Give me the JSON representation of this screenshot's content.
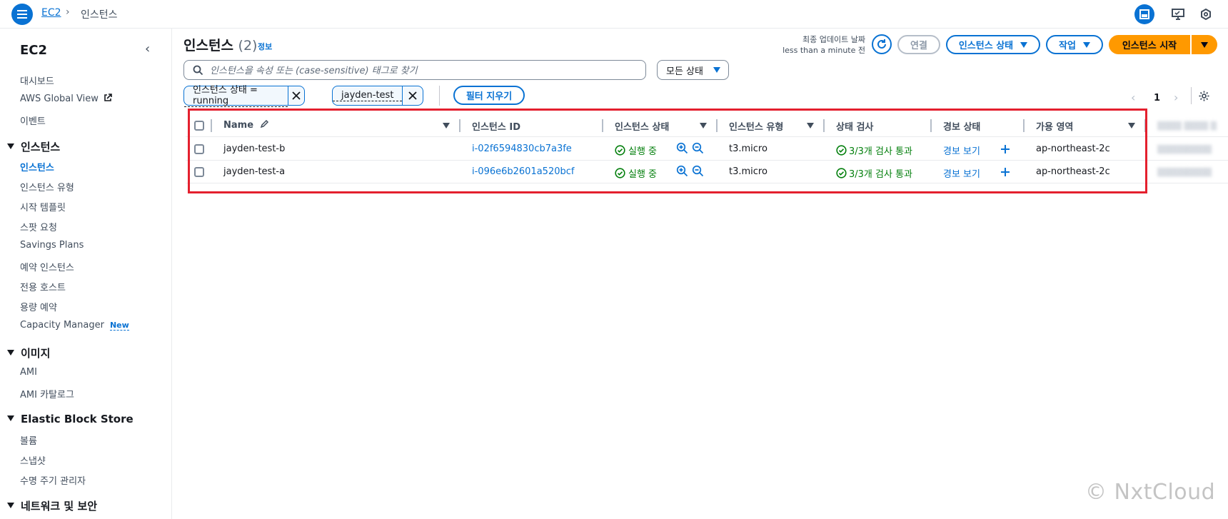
{
  "topbar": {
    "breadcrumb": [
      "EC2",
      "인스턴스"
    ]
  },
  "sidebar": {
    "title": "EC2",
    "top_items": [
      {
        "label": "대시보드"
      },
      {
        "label": "AWS Global View"
      },
      {
        "label": "이벤트"
      }
    ],
    "sections": [
      {
        "title": "인스턴스",
        "items": [
          {
            "label": "인스턴스",
            "active": true
          },
          {
            "label": "인스턴스 유형"
          },
          {
            "label": "시작 템플릿"
          },
          {
            "label": "스팟 요청"
          },
          {
            "label": "Savings Plans"
          },
          {
            "label": "예약 인스턴스"
          },
          {
            "label": "전용 호스트"
          },
          {
            "label": "용량 예약"
          },
          {
            "label": "Capacity Manager",
            "badge": "New"
          }
        ]
      },
      {
        "title": "이미지",
        "items": [
          {
            "label": "AMI"
          },
          {
            "label": "AMI 카탈로그"
          }
        ]
      },
      {
        "title": "Elastic Block Store",
        "items": [
          {
            "label": "볼륨"
          },
          {
            "label": "스냅샷"
          },
          {
            "label": "수명 주기 관리자"
          }
        ]
      },
      {
        "title": "네트워크 및 보안",
        "items": []
      }
    ]
  },
  "header": {
    "title": "인스턴스",
    "count": "(2)",
    "info": "정보",
    "last_update_label": "최종 업데이트 날짜",
    "last_update_value": "less than a minute 전",
    "connect": "연결",
    "instance_state": "인스턴스 상태",
    "actions": "작업",
    "launch": "인스턴스 시작"
  },
  "search": {
    "placeholder": "인스턴스을 속성 또는 (case-sensitive) 태그로 찾기",
    "status_select": "모든 상태"
  },
  "filters": {
    "tokens": [
      "인스턴스 상태 = running",
      "jayden-test"
    ],
    "clear": "필터 지우기"
  },
  "pagination": {
    "page": "1"
  },
  "table": {
    "columns": [
      "Name",
      "인스턴스 ID",
      "인스턴스 상태",
      "인스턴스 유형",
      "상태 검사",
      "경보 상태",
      "가용 영역"
    ],
    "rows": [
      {
        "name": "jayden-test-b",
        "id": "i-02f6594830cb7a3fe",
        "state": "실행 중",
        "type": "t3.micro",
        "check": "3/3개 검사 통과",
        "alarm": "경보 보기",
        "az": "ap-northeast-2c"
      },
      {
        "name": "jayden-test-a",
        "id": "i-096e6b2601a520bcf",
        "state": "실행 중",
        "type": "t3.micro",
        "check": "3/3개 검사 통과",
        "alarm": "경보 보기",
        "az": "ap-northeast-2c"
      }
    ]
  },
  "watermark": "© NxtCloud",
  "colors": {
    "accent": "#0972d3",
    "launch": "#ff9900",
    "success": "#037f0c",
    "highlight": "#e4202e"
  }
}
